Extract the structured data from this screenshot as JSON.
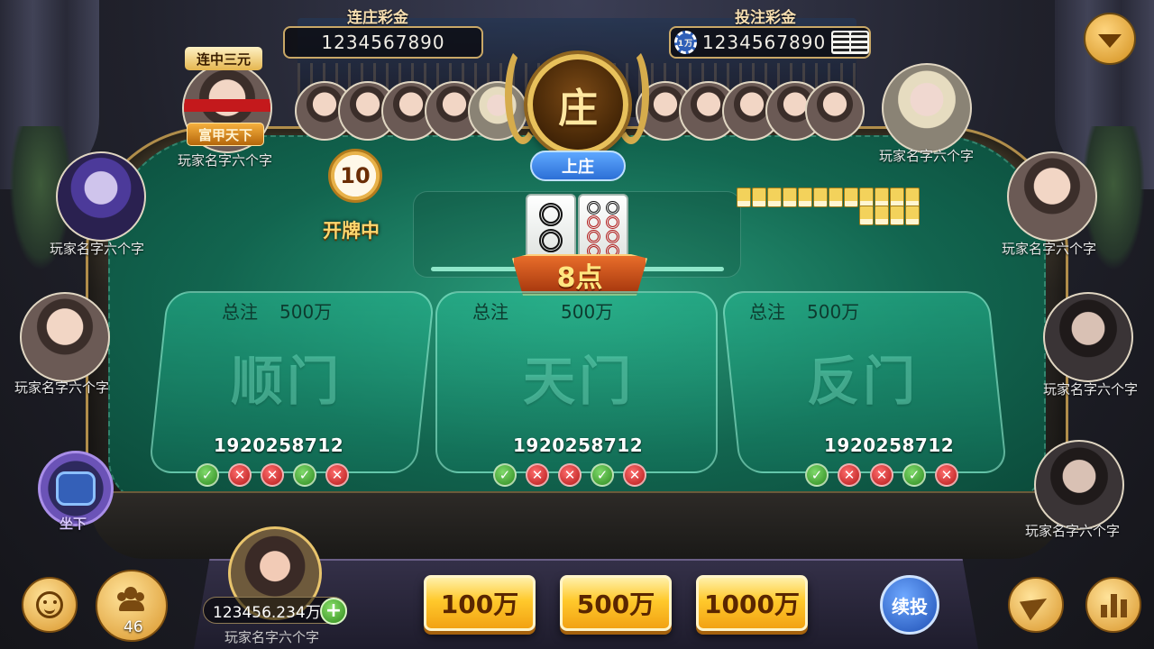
{
  "jackpots": {
    "streak": {
      "title": "连庄彩金",
      "value": "1234567890"
    },
    "bet": {
      "title": "投注彩金",
      "value": "1234567890",
      "chip_label": "1万"
    }
  },
  "banker": {
    "badge": "庄",
    "apply_label": "上庄"
  },
  "clock": {
    "seconds": "10",
    "status": "开牌中"
  },
  "banker_player": {
    "title_tag": "连中三元",
    "rank_tag": "富甲天下",
    "name": "玩家名字六个字"
  },
  "side_players": {
    "left": [
      {
        "name": "玩家名字六个字"
      },
      {
        "name": "玩家名字六个字"
      }
    ],
    "right": [
      {
        "name": "玩家名字六个字"
      },
      {
        "name": "玩家名字六个字"
      },
      {
        "name": "玩家名字六个字"
      },
      {
        "name": "玩家名字六个字"
      }
    ]
  },
  "dealer_hand": {
    "points_label": "8点"
  },
  "zones": [
    {
      "total_label": "总注",
      "total_value": "500万",
      "name": "顺门",
      "amount": "1920258712",
      "history": [
        "win",
        "lose",
        "lose",
        "win",
        "lose"
      ]
    },
    {
      "total_label": "总注",
      "total_value": "500万",
      "name": "天门",
      "amount": "1920258712",
      "history": [
        "win",
        "lose",
        "lose",
        "win",
        "lose"
      ]
    },
    {
      "total_label": "总注",
      "total_value": "500万",
      "name": "反门",
      "amount": "1920258712",
      "history": [
        "win",
        "lose",
        "lose",
        "win",
        "lose"
      ]
    }
  ],
  "seat": {
    "label": "坐下"
  },
  "me": {
    "balance": "123456.234万",
    "plus": "+",
    "name": "玩家名字六个字"
  },
  "online": {
    "count": "46"
  },
  "chips": [
    "100万",
    "500万",
    "1000万"
  ],
  "rebet_label": "续投",
  "marks": {
    "win": "✓",
    "lose": "✕"
  },
  "icons": {
    "menu": "chevron-down-icon",
    "emoji": "smiley-icon",
    "players": "people-icon",
    "share": "paper-plane-icon",
    "stats": "bar-chart-icon",
    "seat": "armchair-icon"
  },
  "colors": {
    "felt": "#12654f",
    "gold": "#e8c15b",
    "win": "#2d8a1f",
    "lose": "#b31818",
    "rebet": "#1e4fb4"
  }
}
